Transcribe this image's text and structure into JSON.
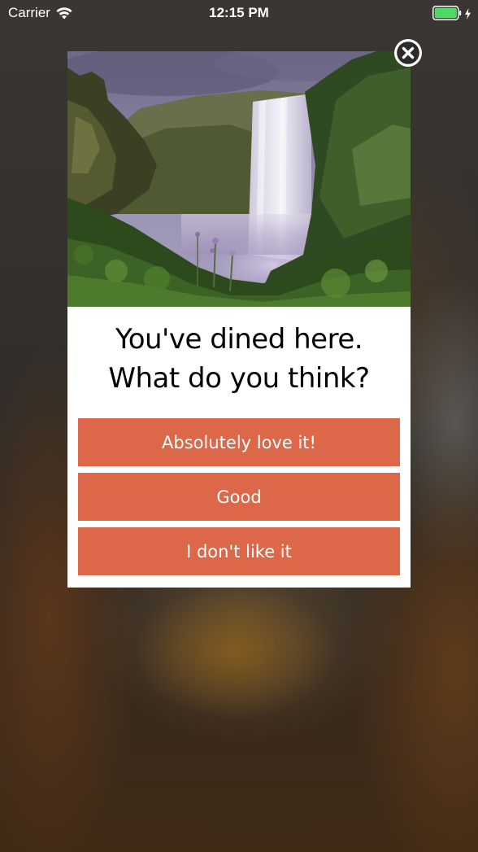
{
  "status_bar": {
    "carrier": "Carrier",
    "time": "12:15 PM",
    "battery_color": "#4cd964",
    "wifi_icon": "wifi-icon",
    "battery_icon": "battery-icon",
    "charging_icon": "charging-bolt-icon"
  },
  "modal": {
    "image_description": "waterfall-photo",
    "prompt_line1": "You've dined here.",
    "prompt_line2": "What do you think?",
    "close_icon": "close-icon",
    "accent_color": "#dc6749",
    "options": [
      {
        "label": "Absolutely love it!"
      },
      {
        "label": "Good"
      },
      {
        "label": "I don't like it"
      }
    ]
  }
}
